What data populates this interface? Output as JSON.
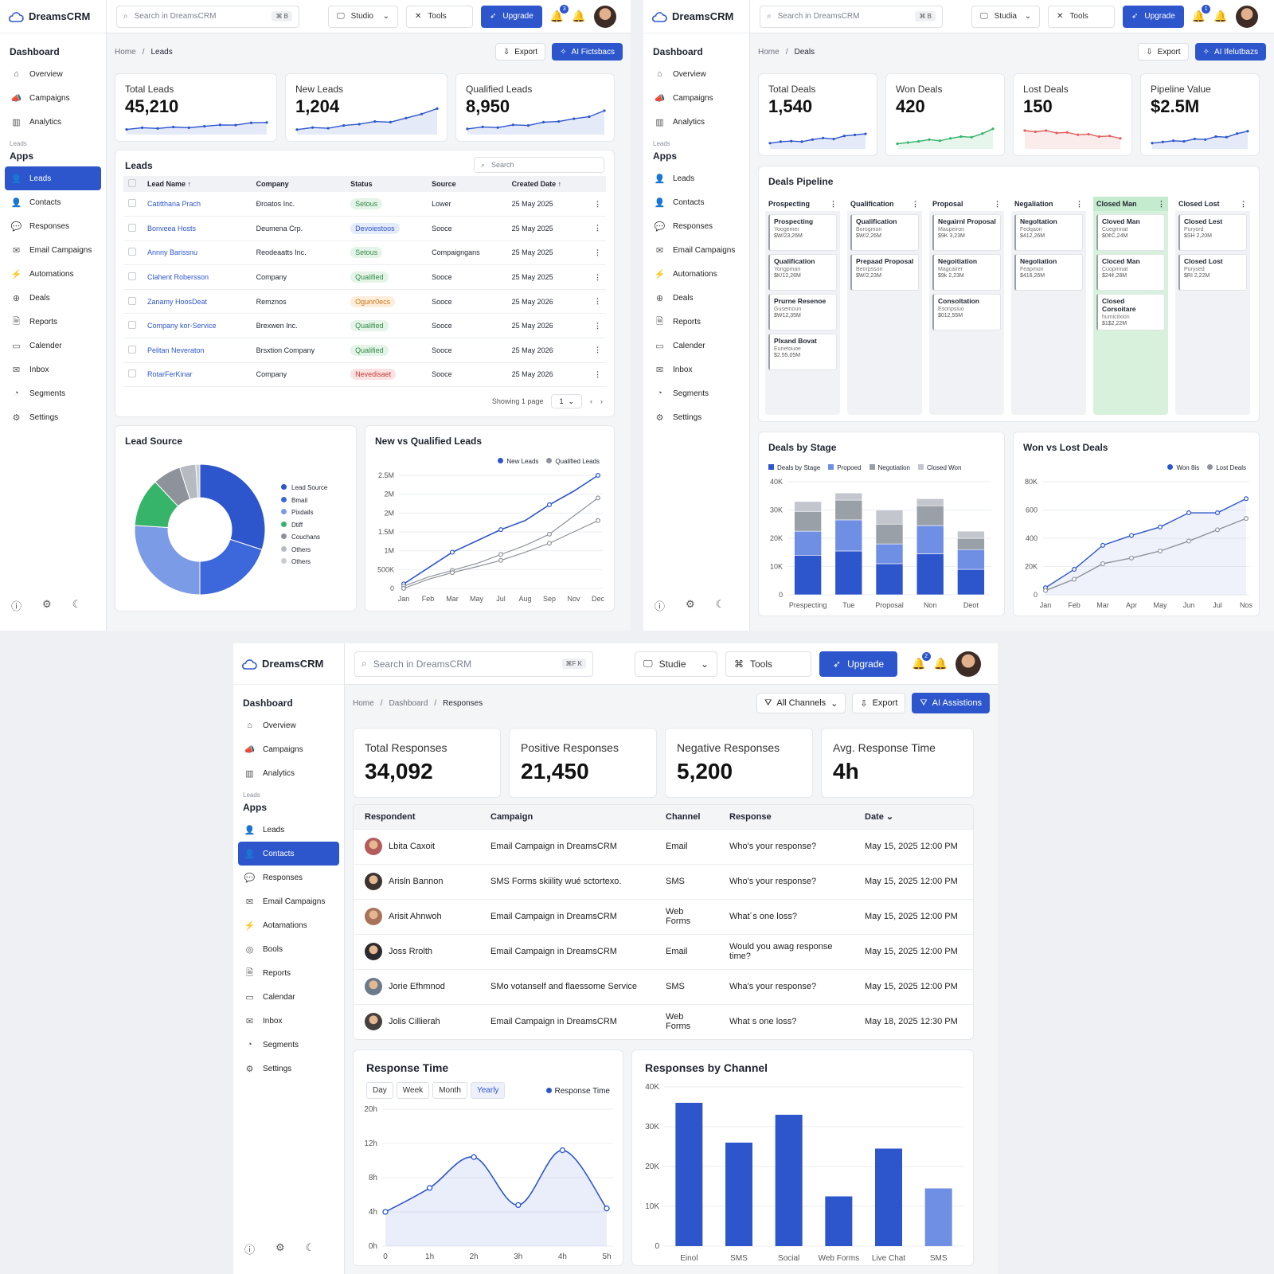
{
  "app": {
    "brand": "DreamsCRM"
  },
  "colors": {
    "accent": "#2d56cc",
    "light": "#7f9ae6",
    "gray": "#9aa0a8",
    "green": "#36b56a",
    "red": "#e06060"
  },
  "panel1": {
    "sidebar": {
      "section_dashboard": "Dashboard",
      "top_items": [
        "Overview",
        "Campaigns",
        "Analytics"
      ],
      "subhead": "Leads",
      "section_apps": "Apps",
      "items": [
        "Leads",
        "Contacts",
        "Responses",
        "Email Campaigns",
        "Automations",
        "Deals",
        "Reports",
        "Calender",
        "Inbox",
        "Segments",
        "Settings"
      ]
    },
    "topbar": {
      "search_placeholder": "Search in DreamsCRM",
      "kbd": "⌘ B",
      "studio": "Studio",
      "tools": "Tools",
      "upgrade": "Upgrade",
      "notif_count": "3"
    },
    "breadcrumb": {
      "home": "Home",
      "current": "Leads"
    },
    "actions": {
      "export": "Export",
      "ai": "AI Fictsbacs"
    },
    "kpis": [
      {
        "label": "Total Leads",
        "value": "45,210"
      },
      {
        "label": "New Leads",
        "value": "1,204"
      },
      {
        "label": "Qualified Leads",
        "value": "8,950"
      }
    ],
    "leads_table": {
      "title": "Leads",
      "search_placeholder": "Search",
      "headers": [
        "Lead Name ↑",
        "Company",
        "Status",
        "Source",
        "Created Date ↑"
      ],
      "rows": [
        {
          "name": "Catitthana Prach",
          "company": "Ðroatos Inc.",
          "status": "Setous",
          "status_type": "green",
          "source": "Lower",
          "date": "25 May 2025"
        },
        {
          "name": "Bonveea Hosts",
          "company": "Deumena Crp.",
          "status": "Devoiestoos",
          "status_type": "blue",
          "source": "Sooce",
          "date": "25 May 2025"
        },
        {
          "name": "Annny Barissnu",
          "company": "Reodeaatts Inc.",
          "status": "Setous",
          "status_type": "green",
          "source": "Compaigngans",
          "date": "25 May 2025"
        },
        {
          "name": "Clahent Robersson",
          "company": "Company",
          "status": "Qualified",
          "status_type": "green",
          "source": "Sooce",
          "date": "25 May 2025"
        },
        {
          "name": "Zanamy HoosDeat",
          "company": "Remznos",
          "status": "Ogunr0ecs",
          "status_type": "orange",
          "source": "Sooce",
          "date": "25 May 2026"
        },
        {
          "name": "Company kor-Service",
          "company": "Brexwen Inc.",
          "status": "Qualified",
          "status_type": "green",
          "source": "Sooce",
          "date": "25 May 2026"
        },
        {
          "name": "Pelitan Neveraton",
          "company": "Brsxtion Company",
          "status": "Qualified",
          "status_type": "green",
          "source": "Sooce",
          "date": "25 May 2026"
        },
        {
          "name": "RotarFerKinar",
          "company": "Company",
          "status": "Nevedisaet",
          "status_type": "red",
          "source": "Sooce",
          "date": "25 May 2026"
        }
      ],
      "footer": "Showing 1 page",
      "page": "1"
    },
    "lead_source": {
      "title": "Lead Source"
    },
    "new_vs_qualified": {
      "title": "New vs Qualified Leads"
    }
  },
  "panel2": {
    "breadcrumb": {
      "home": "Home",
      "current": "Deals"
    },
    "actions": {
      "export": "Export",
      "ai": "AI Ifelutbazs"
    },
    "topbar": {
      "search_placeholder": "Search in DreamsCRM",
      "kbd": "⌘ B",
      "studio": "Studia",
      "tools": "Tools",
      "upgrade": "Upgrade",
      "notif_count": "1"
    },
    "kpis": [
      {
        "label": "Total Deals",
        "value": "1,540"
      },
      {
        "label": "Won Deals",
        "value": "420"
      },
      {
        "label": "Lost Deals",
        "value": "150"
      },
      {
        "label": "Pipeline Value",
        "value": "$2.5M"
      }
    ],
    "pipeline": {
      "title": "Deals Pipeline",
      "columns": [
        {
          "name": "Prospecting",
          "cards": [
            {
              "t": "Prospecting",
              "s": "Yoogemer",
              "a": "$W/23,26M"
            },
            {
              "t": "Qualification",
              "s": "Yongpman",
              "a": "$K/12,26M"
            },
            {
              "t": "Prurne Resenoe",
              "s": "Gusemoun",
              "a": "$W12,35M"
            },
            {
              "t": "Plxand Bovat",
              "s": "Eunetouoe",
              "a": "$2.55.05M"
            }
          ]
        },
        {
          "name": "Qualification",
          "cards": [
            {
              "t": "Qualification",
              "s": "Borogmon",
              "a": "$W/2,26M"
            },
            {
              "t": "Prepaad Proposal",
              "s": "Beorpsson",
              "a": "$W/2,23M"
            }
          ]
        },
        {
          "name": "Proposal",
          "cards": [
            {
              "t": "Negairnl Proposal",
              "s": "Maupeiron",
              "a": "$9K 3,23M"
            },
            {
              "t": "Negoitiation",
              "s": "Magcairer",
              "a": "$9k 2,23M"
            },
            {
              "t": "Consoltation",
              "s": "Esonpsiuo",
              "a": "$012,55M"
            }
          ]
        },
        {
          "name": "Negaliation",
          "cards": [
            {
              "t": "Negoltation",
              "s": "Fedqaon",
              "a": "$412,26M"
            },
            {
              "t": "Negoliation",
              "s": "Feapmon",
              "a": "$416,26M"
            }
          ]
        },
        {
          "name": "Closed Man",
          "cards": [
            {
              "t": "Cloved Man",
              "s": "Cuegmnat",
              "a": "$0¢C,24M"
            },
            {
              "t": "Cloced Man",
              "s": "Cuopmnat",
              "a": "$24¢,28M"
            },
            {
              "t": "Closed Corsoitare",
              "s": "humicilxion",
              "a": "$1$2,22M"
            }
          ]
        },
        {
          "name": "Closed Lost",
          "cards": [
            {
              "t": "Closed Lest",
              "s": "Puryord",
              "a": "$SH 2,20M"
            },
            {
              "t": "Closed Lost",
              "s": "Purysed",
              "a": "$RI 2,22M"
            }
          ]
        }
      ]
    },
    "deals_by_stage": {
      "title": "Deals by Stage"
    },
    "won_vs_lost": {
      "title": "Won vs Lost Deals"
    }
  },
  "panel3": {
    "sidebar_items": [
      "Leads",
      "Contacts",
      "Responses",
      "Email Campaigns",
      "Aotamations",
      "Bools",
      "Reports",
      "Calendar",
      "Inbox",
      "Segments",
      "Settings"
    ],
    "topbar": {
      "search_placeholder": "Search in DreamsCRM",
      "kbd": "⌘F K",
      "studio": "Studie",
      "tools": "Tools",
      "upgrade": "Upgrade",
      "notif_count": "2"
    },
    "breadcrumb": {
      "home": "Home",
      "mid": "Dashboard",
      "current": "Responses"
    },
    "actions": {
      "channels": "All Channels",
      "export": "Export",
      "ai": "AI Assistions"
    },
    "kpis": [
      {
        "label": "Total Responses",
        "value": "34,092"
      },
      {
        "label": "Positive Responses",
        "value": "21,450"
      },
      {
        "label": "Negative Responses",
        "value": "5,200"
      },
      {
        "label": "Avg. Response Time",
        "value": "4h"
      }
    ],
    "responses_table": {
      "headers": [
        "Respondent",
        "Campaign",
        "Channel",
        "Response",
        "Date"
      ],
      "rows": [
        {
          "name": "Lbita Caxoit",
          "campaign": "Email Campaign in DreamsCRM",
          "channel": "Email",
          "response": "Who's your response?",
          "date": "May 15, 2025 12:00 PM",
          "avatar": "#b45c5c"
        },
        {
          "name": "Arisln Bannon",
          "campaign": "SMS Forms skiility wué sctortexo.",
          "channel": "SMS",
          "response": "Who's your response?",
          "date": "May 15, 2025 12:00 PM",
          "avatar": "#3b3330"
        },
        {
          "name": "Arisit Ahnwoh",
          "campaign": "Email Campaign in DreamsCRM",
          "channel": "Web Forms",
          "response": "What´s one loss?",
          "date": "May 15, 2025 12:00 PM",
          "avatar": "#a8735a"
        },
        {
          "name": "Joss Rrolth",
          "campaign": "Email Campaign in DreamsCRM",
          "channel": "Email",
          "response": "Would you awag response time?",
          "date": "May 15, 2025 12:00 PM",
          "avatar": "#2c2a2e"
        },
        {
          "name": "Jorie Efhmnod",
          "campaign": "SMo votanself and flaessome Service",
          "channel": "SMS",
          "response": "Wha's your response?",
          "date": "May 15, 2025 12:00 PM",
          "avatar": "#6b7a8a"
        },
        {
          "name": "Jolis Cillierah",
          "campaign": "Email Campaign in DreamsCRM",
          "channel": "Web Forms",
          "response": "What s one loss?",
          "date": "May 18, 2025 12:30 PM",
          "avatar": "#454040"
        }
      ]
    },
    "response_time": {
      "title": "Response Time",
      "tabs": [
        "Day",
        "Week",
        "Month",
        "Yearly"
      ],
      "active_tab": "Yearly"
    },
    "responses_by_channel": {
      "title": "Responses by Channel"
    }
  },
  "chart_data": [
    {
      "id": "total-leads-spark",
      "type": "line",
      "values": [
        2,
        3,
        2.6,
        3.4,
        3,
        3.8,
        4.6,
        4.5,
        5.8,
        6
      ],
      "ylim": [
        0,
        10
      ]
    },
    {
      "id": "new-leads-spark",
      "type": "area",
      "values": [
        1,
        1.6,
        1.4,
        2.2,
        2.6,
        3.4,
        3.2,
        4.4,
        5.6,
        7.2
      ],
      "ylim": [
        0,
        8
      ]
    },
    {
      "id": "qualified-leads-spark",
      "type": "area",
      "values": [
        1.2,
        1.8,
        1.6,
        2.4,
        2.2,
        3.2,
        3.4,
        4.2,
        4.8,
        6.6
      ],
      "ylim": [
        0,
        8
      ]
    },
    {
      "id": "lead-source",
      "type": "pie",
      "categories": [
        "Lead Source",
        "Bmail",
        "Pixdails",
        "Dtiff",
        "Couchans",
        "Others",
        "Others"
      ],
      "values": [
        30,
        20,
        26,
        12,
        7,
        4,
        1
      ],
      "colors": [
        "#2d56cc",
        "#3c68db",
        "#7c9be6",
        "#36b56a",
        "#8e939b",
        "#b6bac1",
        "#c9ccd2"
      ]
    },
    {
      "id": "new-vs-qualified",
      "type": "line",
      "x": [
        "Jan",
        "Feb",
        "Mar",
        "May",
        "Jul",
        "Aug",
        "Sep",
        "Nov",
        "Dec"
      ],
      "yticks": [
        "0",
        "500K",
        "1M",
        "1.5M",
        "2M",
        "2M",
        "2.5M"
      ],
      "ylim": [
        0,
        2.5
      ],
      "series": [
        {
          "name": "New Leads",
          "values": [
            0.1,
            0.45,
            0.8,
            1.05,
            1.3,
            1.5,
            1.85,
            2.15,
            2.5
          ],
          "color": "#2d56cc"
        },
        {
          "name": "Qualified Leads",
          "values": [
            0.05,
            0.25,
            0.4,
            0.55,
            0.75,
            0.95,
            1.2,
            1.6,
            2.0
          ],
          "color": "#8e939b"
        },
        {
          "name": "",
          "values": [
            0,
            0.2,
            0.35,
            0.48,
            0.62,
            0.8,
            1.0,
            1.25,
            1.5
          ],
          "color": "#8e939b"
        }
      ]
    },
    {
      "id": "total-deals-spark",
      "type": "area",
      "values": [
        1.6,
        2.2,
        2.4,
        2.2,
        3,
        3.6,
        3.2,
        4.4,
        4.8,
        5.2
      ],
      "ylim": [
        0,
        8
      ],
      "color": "#2d56cc"
    },
    {
      "id": "won-deals-spark",
      "type": "area",
      "values": [
        1.2,
        1.6,
        2,
        2.6,
        2.2,
        3,
        3.6,
        3.4,
        4.6,
        6.2
      ],
      "ylim": [
        0,
        8
      ],
      "color": "#36b56a"
    },
    {
      "id": "lost-deals-spark",
      "type": "area",
      "values": [
        5.6,
        5.2,
        5.6,
        4.8,
        5,
        4.2,
        4.4,
        3.6,
        3.8,
        3
      ],
      "ylim": [
        0,
        8
      ],
      "color": "#e06060"
    },
    {
      "id": "pipeline-value-spark",
      "type": "area",
      "values": [
        1.4,
        1.8,
        2.2,
        2,
        2.8,
        2.6,
        3.6,
        3.4,
        4.6,
        5.4
      ],
      "ylim": [
        0,
        8
      ],
      "color": "#2d56cc"
    },
    {
      "id": "deals-by-stage",
      "type": "bar",
      "categories": [
        "Prespecting",
        "Tue",
        "Proposal",
        "Non",
        "Deot"
      ],
      "yticks": [
        "0",
        "10K",
        "20K",
        "30K",
        "40K"
      ],
      "ylim": [
        0,
        40
      ],
      "series": [
        {
          "name": "Deals by Stage",
          "values": [
            14,
            15.5,
            11,
            14.5,
            9
          ],
          "color": "#2d56cc"
        },
        {
          "name": "Propoed",
          "values": [
            8.5,
            11,
            7,
            10,
            7
          ],
          "color": "#6f8fe4"
        },
        {
          "name": "Negotiation",
          "values": [
            7,
            7,
            7,
            7,
            4
          ],
          "color": "#9aa0a8"
        },
        {
          "name": "Closed Won",
          "values": [
            3.5,
            2.5,
            5,
            2.5,
            2.5
          ],
          "color": "#c3c7cd"
        }
      ]
    },
    {
      "id": "won-vs-lost",
      "type": "line",
      "x": [
        "Jan",
        "Feb",
        "Mar",
        "Apr",
        "May",
        "Jun",
        "Jul",
        "Nos"
      ],
      "yticks": [
        "0",
        "20K",
        "400",
        "600",
        "80K"
      ],
      "ylim": [
        0,
        80
      ],
      "series": [
        {
          "name": "Won 8is",
          "values": [
            5,
            18,
            35,
            42,
            48,
            58,
            58,
            68
          ],
          "color": "#2d56cc"
        },
        {
          "name": "Lost Deals",
          "values": [
            3,
            11,
            22,
            26,
            31,
            38,
            46,
            54
          ],
          "color": "#8e939b"
        }
      ]
    },
    {
      "id": "response-time",
      "type": "line",
      "x": [
        "0",
        "1h",
        "2h",
        "3h",
        "4h",
        "5h"
      ],
      "yticks": [
        "0h",
        "4h",
        "8h",
        "12h",
        "20h"
      ],
      "ylim": [
        0,
        20
      ],
      "series": [
        {
          "name": "Response Time",
          "values": [
            5,
            8.5,
            13,
            6,
            14,
            5.5
          ],
          "color": "#2d56cc"
        }
      ]
    },
    {
      "id": "responses-by-channel",
      "type": "bar",
      "categories": [
        "Einol",
        "SMS",
        "Social",
        "Web Forms",
        "Live Chat",
        "SMS"
      ],
      "yticks": [
        "0",
        "10K",
        "20K",
        "30K",
        "40K"
      ],
      "ylim": [
        0,
        40
      ],
      "values": [
        36,
        26,
        33,
        12.5,
        24.5,
        14.5
      ],
      "colors": [
        "#2d56cc",
        "#2d56cc",
        "#2d56cc",
        "#2d56cc",
        "#2d56cc",
        "#6f8fe4"
      ]
    }
  ]
}
